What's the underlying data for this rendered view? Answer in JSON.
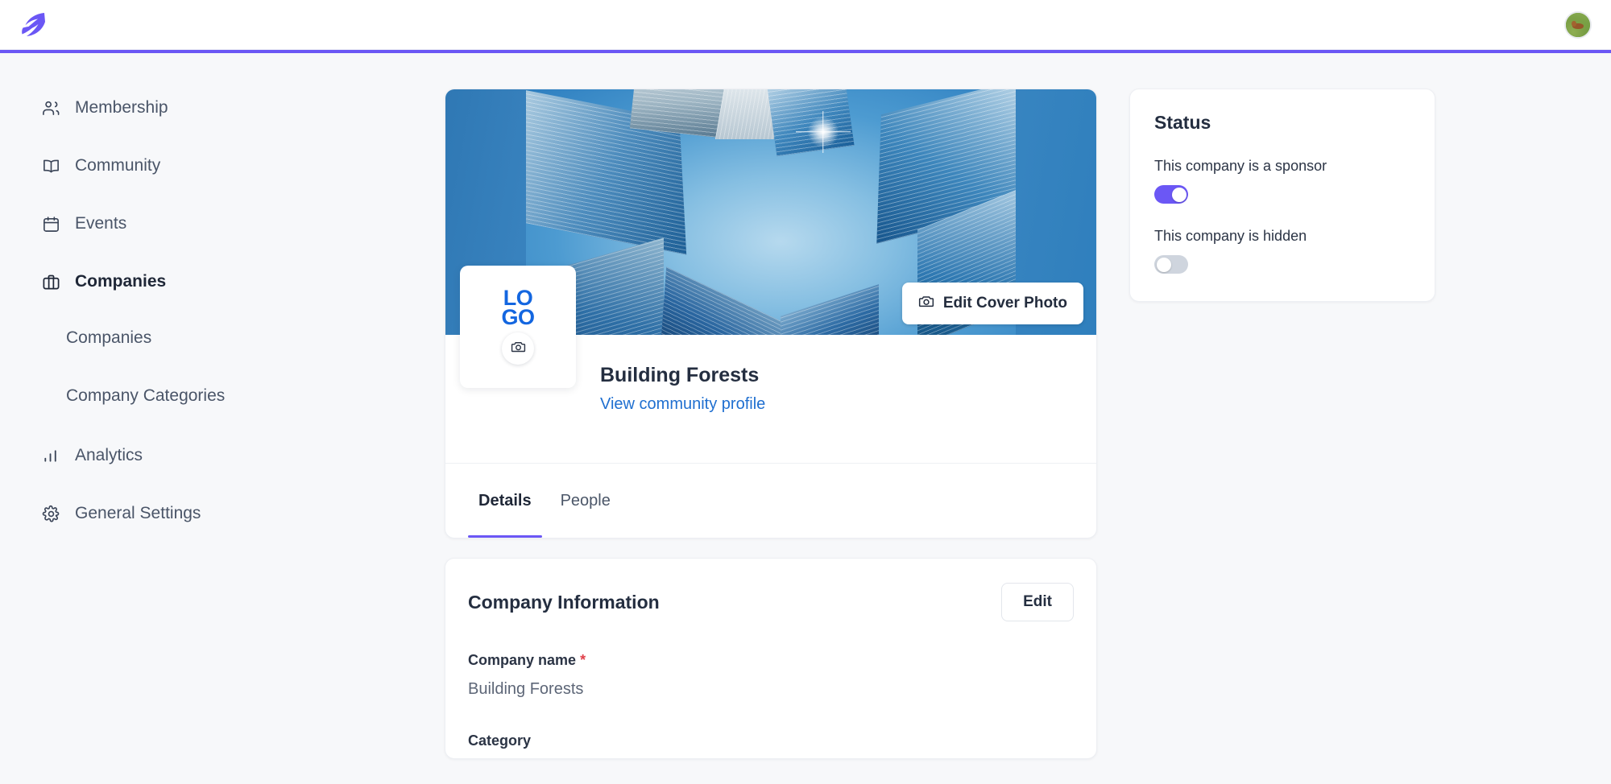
{
  "brand": {
    "logo_icon": "leaf-logo-icon",
    "accent_color": "#6b57f5"
  },
  "topbar": {
    "avatar_alt": "user-avatar"
  },
  "sidebar": {
    "items": [
      {
        "label": "Membership",
        "icon": "users-icon",
        "active": false,
        "sub": false
      },
      {
        "label": "Community",
        "icon": "book-icon",
        "active": false,
        "sub": false
      },
      {
        "label": "Events",
        "icon": "calendar-icon",
        "active": false,
        "sub": false
      },
      {
        "label": "Companies",
        "icon": "briefcase-icon",
        "active": true,
        "sub": false
      },
      {
        "label": "Companies",
        "icon": "",
        "active": false,
        "sub": true
      },
      {
        "label": "Company Categories",
        "icon": "",
        "active": false,
        "sub": true
      },
      {
        "label": "Analytics",
        "icon": "bar-chart-icon",
        "active": false,
        "sub": false
      },
      {
        "label": "General Settings",
        "icon": "gear-icon",
        "active": false,
        "sub": false
      }
    ]
  },
  "profile": {
    "cover": {
      "edit_button_label": "Edit Cover Photo",
      "edit_button_icon": "camera-icon",
      "alt": "Looking up at blue glass skyscrapers against a clear blue sky"
    },
    "logo": {
      "line1": "LO",
      "line2": "GO",
      "color": "#1366e0",
      "upload_icon": "camera-icon"
    },
    "company_name": "Building Forests",
    "community_link": "View community profile",
    "tabs": [
      {
        "label": "Details",
        "active": true
      },
      {
        "label": "People",
        "active": false
      }
    ]
  },
  "company_information": {
    "title": "Company Information",
    "edit_label": "Edit",
    "fields": [
      {
        "label": "Company name",
        "required": true,
        "value": "Building Forests"
      },
      {
        "label": "Category",
        "required": false,
        "value": ""
      }
    ]
  },
  "status": {
    "title": "Status",
    "toggles": [
      {
        "label": "This company is a sponsor",
        "on": true
      },
      {
        "label": "This company is hidden",
        "on": false
      }
    ]
  }
}
